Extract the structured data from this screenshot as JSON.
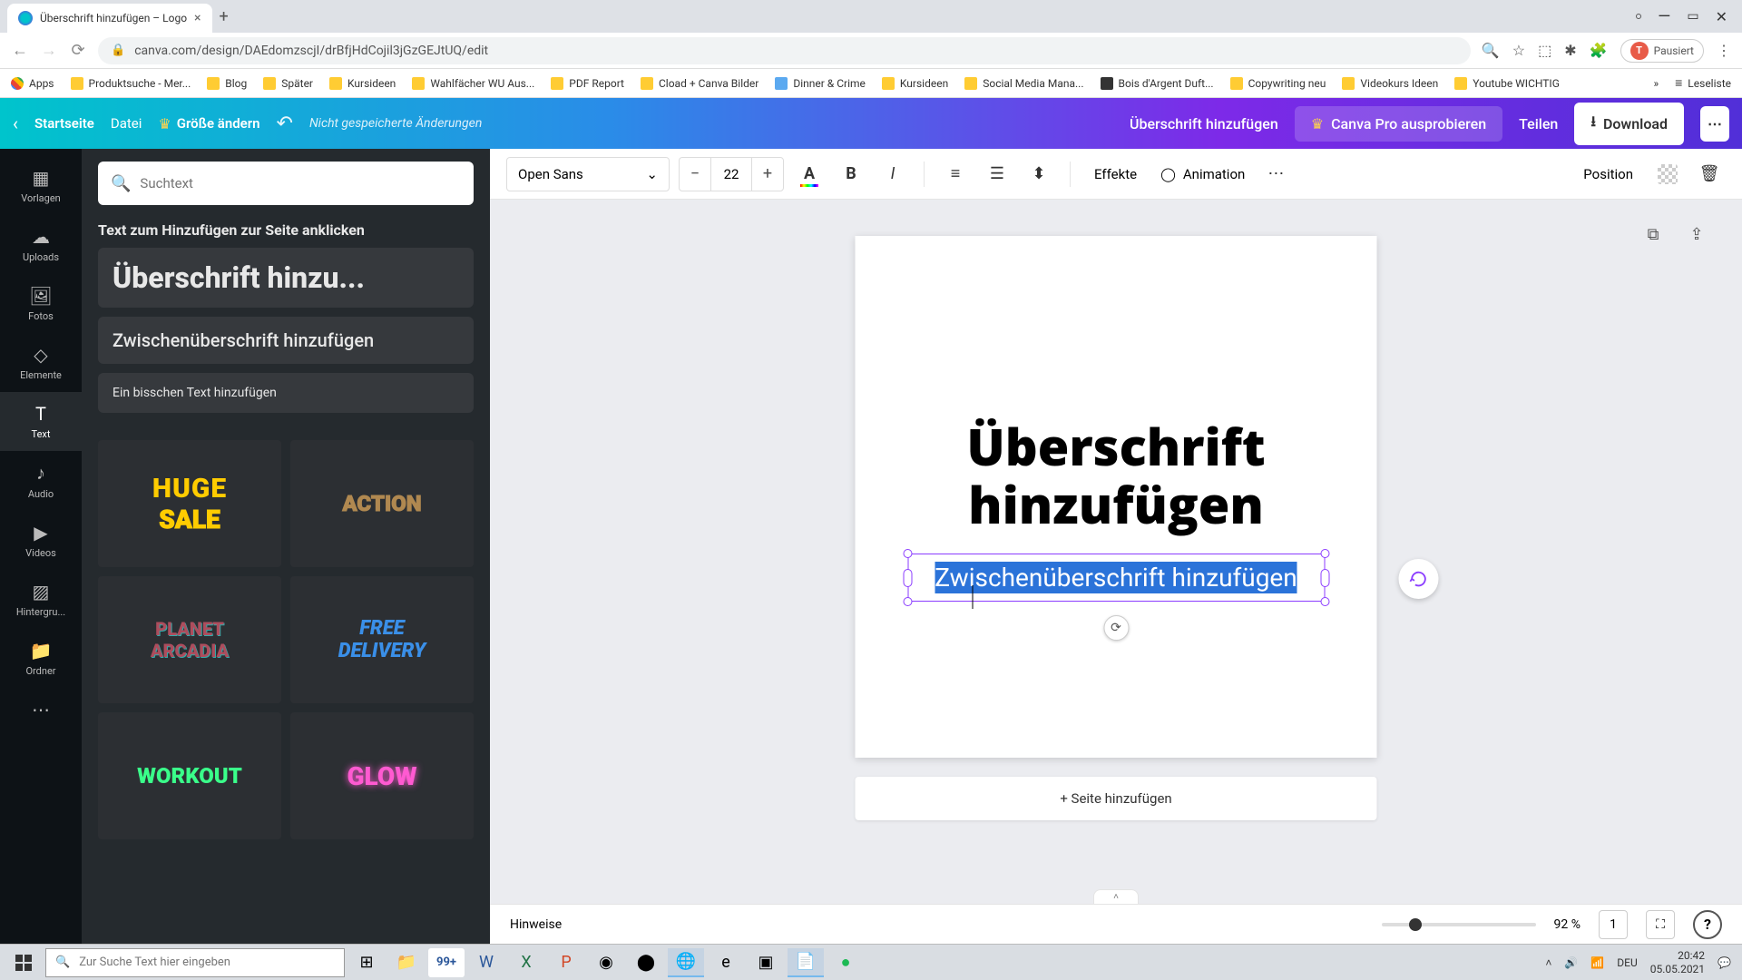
{
  "browser": {
    "tab_title": "Überschrift hinzufügen – Logo",
    "url": "canva.com/design/DAEdomzscjI/drBfjHdCojil3jGzGEJtUQ/edit",
    "paused_label": "Pausiert",
    "bookmarks": [
      "Apps",
      "Produktsuche - Mer...",
      "Blog",
      "Später",
      "Kursideen",
      "Wahlfächer WU Aus...",
      "PDF Report",
      "Cload + Canva Bilder",
      "Dinner & Crime",
      "Kursideen",
      "Social Media Mana...",
      "Bois d'Argent Duft...",
      "Copywriting neu",
      "Videokurs Ideen",
      "Youtube WICHTIG",
      "Leseliste"
    ]
  },
  "header": {
    "home": "Startseite",
    "file": "Datei",
    "resize": "Größe ändern",
    "unsaved": "Nicht gespeicherte Änderungen",
    "doc_title": "Überschrift hinzufügen",
    "pro": "Canva Pro ausprobieren",
    "share": "Teilen",
    "download": "Download"
  },
  "rail": {
    "templates": "Vorlagen",
    "uploads": "Uploads",
    "photos": "Fotos",
    "elements": "Elemente",
    "text": "Text",
    "audio": "Audio",
    "videos": "Videos",
    "background": "Hintergru...",
    "folders": "Ordner"
  },
  "panel": {
    "search_placeholder": "Suchtext",
    "title": "Text zum Hinzufügen zur Seite anklicken",
    "h1": "Überschrift hinzu...",
    "h2": "Zwischenüberschrift hinzufügen",
    "body": "Ein bisschen Text hinzufügen",
    "combos": {
      "huge": "HUGE",
      "sale": "SALE",
      "action": "ACTION",
      "planet1": "PLANET",
      "planet2": "ARCADIA",
      "free1": "FREE",
      "free2": "DELIVERY",
      "workout": "WORKOUT",
      "glow": "GLOW"
    }
  },
  "toolbar": {
    "font": "Open Sans",
    "size": "22",
    "effects": "Effekte",
    "animation": "Animation",
    "position": "Position"
  },
  "canvas": {
    "heading": "Überschrift hinzufügen",
    "subheading": "Zwischenüberschrift hinzufügen",
    "add_page": "+ Seite hinzufügen",
    "hints": "Hinweise",
    "zoom": "92 %",
    "page_num": "1"
  },
  "taskbar": {
    "search": "Zur Suche Text hier eingeben",
    "count": "99+",
    "lang": "DEU",
    "time": "20:42",
    "date": "05.05.2021"
  }
}
